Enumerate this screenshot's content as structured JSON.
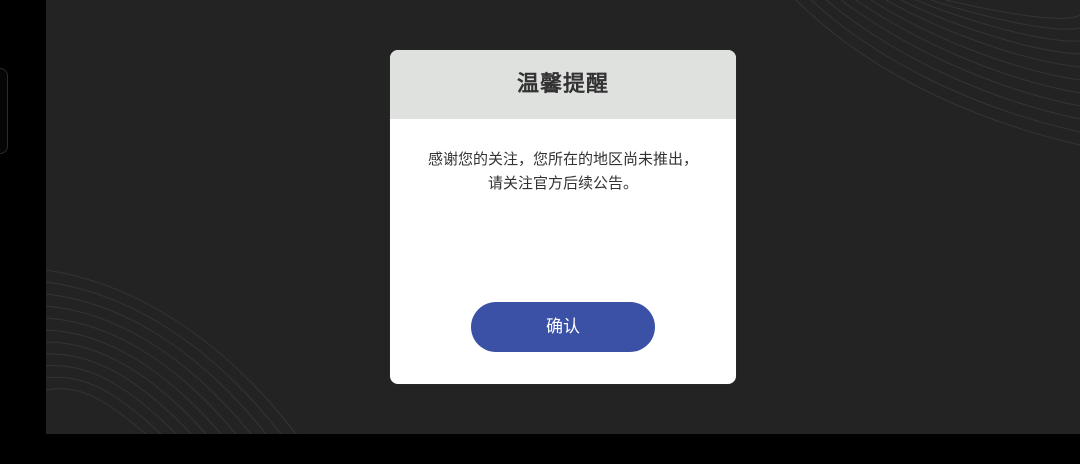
{
  "dialog": {
    "title": "温馨提醒",
    "message_line_1": "感谢您的关注，您所在的地区尚未推出，",
    "message_line_2": "请关注官方后续公告。",
    "confirm_label": "确认"
  },
  "colors": {
    "screen_background": "#000000",
    "stage_background": "#232323",
    "dialog_header": "#dfe1df",
    "dialog_body": "#ffffff",
    "title_text": "#333333",
    "message_text": "#333333",
    "confirm_button": "#3b51a5",
    "confirm_text": "#ffffff"
  }
}
